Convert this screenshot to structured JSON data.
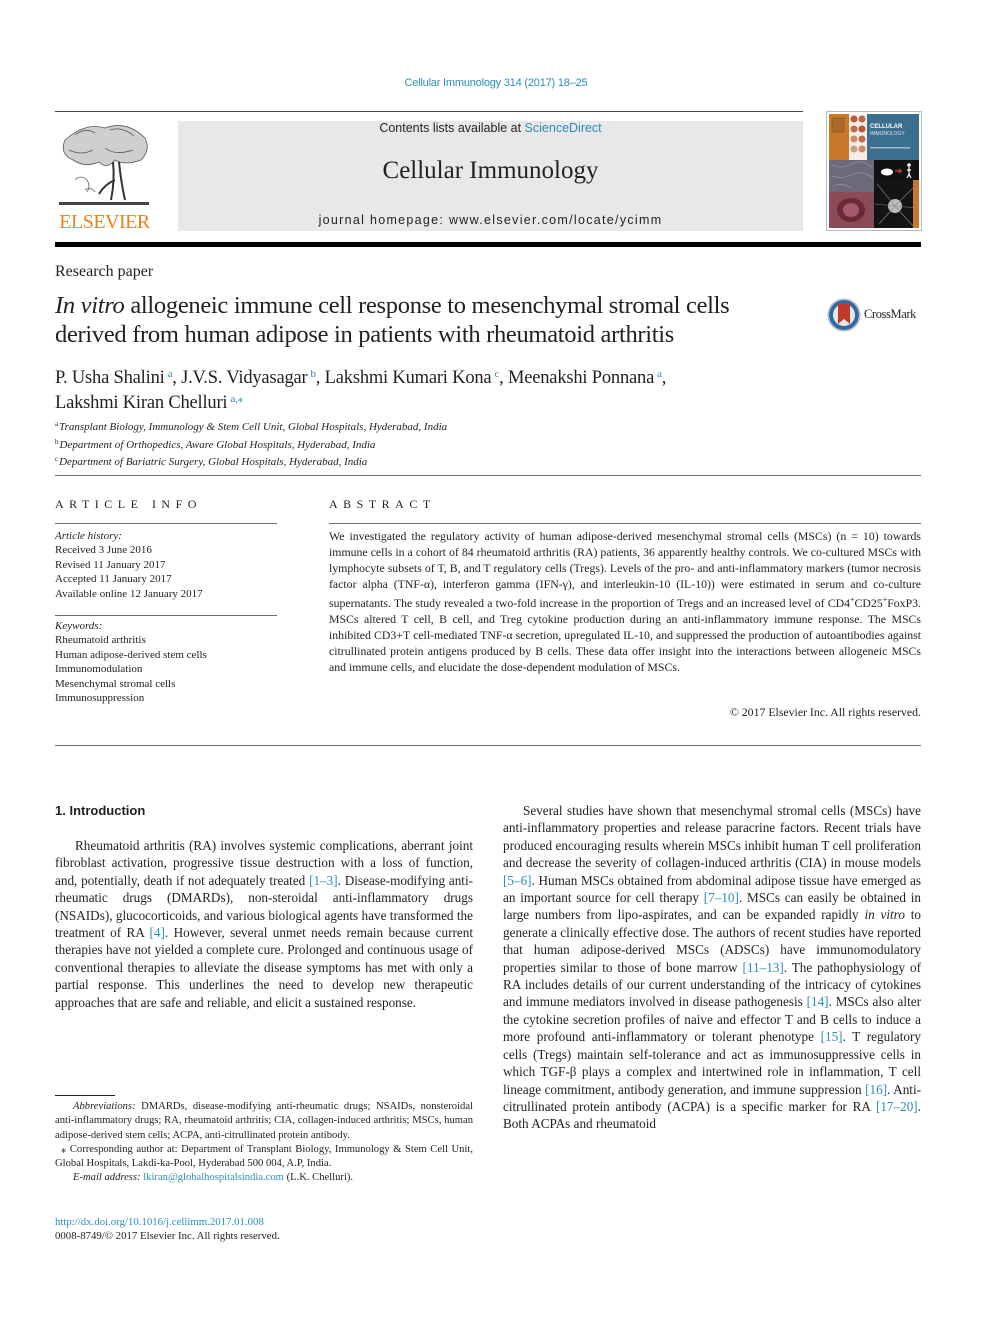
{
  "citation": "Cellular Immunology 314 (2017) 18–25",
  "header": {
    "publisher_wordmark": "ELSEVIER",
    "contents_prefix": "Contents lists available at ",
    "contents_link": "ScienceDirect",
    "journal_title": "Cellular Immunology",
    "homepage": "journal homepage: www.elsevier.com/locate/ycimm",
    "cover_title_line1": "CELLULAR",
    "cover_title_line2": "IMMUNOLOGY"
  },
  "article": {
    "type": "Research paper",
    "title_italic": "In vitro",
    "title_rest_line1": " allogeneic immune cell response to mesenchymal stromal cells",
    "title_line2": "derived from human adipose in patients with rheumatoid arthritis",
    "crossmark_label": "CrossMark",
    "authors": [
      {
        "name": "P. Usha Shalini",
        "sup": "a",
        "sep": ", "
      },
      {
        "name": "J.V.S. Vidyasagar",
        "sup": "b",
        "sep": ", "
      },
      {
        "name": "Lakshmi Kumari Kona",
        "sup": "c",
        "sep": ", "
      },
      {
        "name": "Meenakshi Ponnana",
        "sup": "a",
        "sep": ","
      },
      {
        "name": "Lakshmi Kiran Chelluri",
        "sup": "a,⁎",
        "sep": ""
      }
    ],
    "affiliations": [
      {
        "key": "a",
        "text": "Transplant Biology, Immunology & Stem Cell Unit, Global Hospitals, Hyderabad, India"
      },
      {
        "key": "b",
        "text": "Department of Orthopedics, Aware Global Hospitals, Hyderabad, India"
      },
      {
        "key": "c",
        "text": "Department of Bariatric Surgery, Global Hospitals, Hyderabad, India"
      }
    ]
  },
  "article_info": {
    "heading": "ARTICLE INFO",
    "history_label": "Article history:",
    "history": [
      "Received 3 June 2016",
      "Revised 11 January 2017",
      "Accepted 11 January 2017",
      "Available online 12 January 2017"
    ],
    "keywords_label": "Keywords:",
    "keywords": [
      "Rheumatoid arthritis",
      "Human adipose-derived stem cells",
      "Immunomodulation",
      "Mesenchymal stromal cells",
      "Immunosuppression"
    ]
  },
  "abstract": {
    "heading": "ABSTRACT",
    "text_part1": "We investigated the regulatory activity of human adipose-derived mesenchymal stromal cells (MSCs) (n = 10) towards immune cells in a cohort of 84 rheumatoid arthritis (RA) patients, 36 apparently healthy controls. We co-cultured MSCs with lymphocyte subsets of T, B, and T regulatory cells (Tregs). Levels of the pro- and anti-inflammatory markers (tumor necrosis factor alpha (TNF-α), interferon gamma (IFN-γ), and interleukin-10 (IL-10)) were estimated in serum and co-culture supernatants. The study revealed a two-fold increase in the proportion of Tregs and an increased level of CD4",
    "sup1": "+",
    "text_part2": "CD25",
    "sup2": "+",
    "text_part3": "FoxP3. MSCs altered T cell, B cell, and Treg cytokine production during an anti-inflammatory immune response. The MSCs inhibited CD3+T cell-mediated TNF-α secretion, upregulated IL-10, and suppressed the production of autoantibodies against citrullinated protein antigens produced by B cells. These data offer insight into the interactions between allogeneic MSCs and immune cells, and elucidate the dose-dependent modulation of MSCs.",
    "copyright": "© 2017 Elsevier Inc. All rights reserved."
  },
  "introduction": {
    "heading": "1. Introduction",
    "left_p1": [
      {
        "t": "Rheumatoid arthritis (RA) involves systemic complications, aberrant joint fibroblast activation, progressive tissue destruction with a loss of function, and, potentially, death if not adequately treated "
      },
      {
        "r": "[1–3]"
      },
      {
        "t": ". Disease-modifying anti-rheumatic drugs (DMARDs), non-steroidal anti-inflammatory drugs (NSAIDs), glucocorticoids, and various biological agents have transformed the treatment of RA "
      },
      {
        "r": "[4]"
      },
      {
        "t": ". However, several unmet needs remain because current therapies have not yielded a complete cure. Prolonged and continuous usage of conventional therapies to alleviate the disease symptoms has met with only a partial response. This underlines the need to develop new therapeutic approaches that are safe and reliable, and elicit a sustained response."
      }
    ],
    "right_p1": [
      {
        "t": "Several studies have shown that mesenchymal stromal cells (MSCs) have anti-inflammatory properties and release paracrine factors. Recent trials have produced encouraging results wherein MSCs inhibit human T cell proliferation and decrease the severity of collagen-induced arthritis (CIA) in mouse models "
      },
      {
        "r": "[5–6]"
      },
      {
        "t": ". Human MSCs obtained from abdominal adipose tissue have emerged as an important source for cell therapy "
      },
      {
        "r": "[7–10]"
      },
      {
        "t": ". MSCs can easily be obtained in large numbers from lipo-aspirates, and can be expanded rapidly "
      },
      {
        "i": "in vitro"
      },
      {
        "t": " to generate a clinically effective dose. The authors of recent studies have reported that human adipose-derived MSCs (ADSCs) have immunomodulatory properties similar to those of bone marrow "
      },
      {
        "r": "[11–13]"
      },
      {
        "t": ". The patho­physiology of RA includes details of our current understanding of the intricacy of cytokines and immune mediators involved in dis­ease pathogenesis "
      },
      {
        "r": "[14]"
      },
      {
        "t": ". MSCs also alter the cytokine secretion pro­files of naive and effector T and B cells to induce a more profound anti-inflammatory or tolerant phenotype "
      },
      {
        "r": "[15]"
      },
      {
        "t": ". T regulatory cells (Tregs) maintain self-tolerance and act as immunosuppressive cells in which TGF-β plays a complex and intertwined role in inflamma­tion, T cell lineage commitment, antibody generation, and immune suppression "
      },
      {
        "r": "[16]"
      },
      {
        "t": ". Anti-citrullinated protein antibody (ACPA) is a specific marker for RA "
      },
      {
        "r": "[17–20]"
      },
      {
        "t": ". Both ACPAs and rheumatoid"
      }
    ]
  },
  "footnotes": {
    "abbrev_label": "Abbreviations:",
    "abbrev_text": " DMARDs, disease-modifying anti-rheumatic drugs; NSAIDs, nonsteroidal anti-inflammatory drugs; RA, rheumatoid arthritis; CIA, collagen-induced arthritis; MSCs, human adipose-derived stem cells; ACPA, anti-citrullinated protein antibody.",
    "corresponding": "⁎ Corresponding author at: Department of Transplant Biology, Immunology & Stem Cell Unit, Global Hospitals, Lakdi-ka-Pool, Hyderabad 500 004, A.P, India.",
    "email_label": "E-mail address:",
    "email": "lkiran@globalhospitalsindia.com",
    "email_suffix": " (L.K. Chelluri).",
    "doi": "http://dx.doi.org/10.1016/j.cellimm.2017.01.008",
    "issn": "0008-8749/© 2017 Elsevier Inc. All rights reserved."
  },
  "colors": {
    "link": "#2a8db8",
    "elsevier_orange": "#f07f1a",
    "masthead_bg": "#e8e8e8",
    "text": "#231f20"
  }
}
